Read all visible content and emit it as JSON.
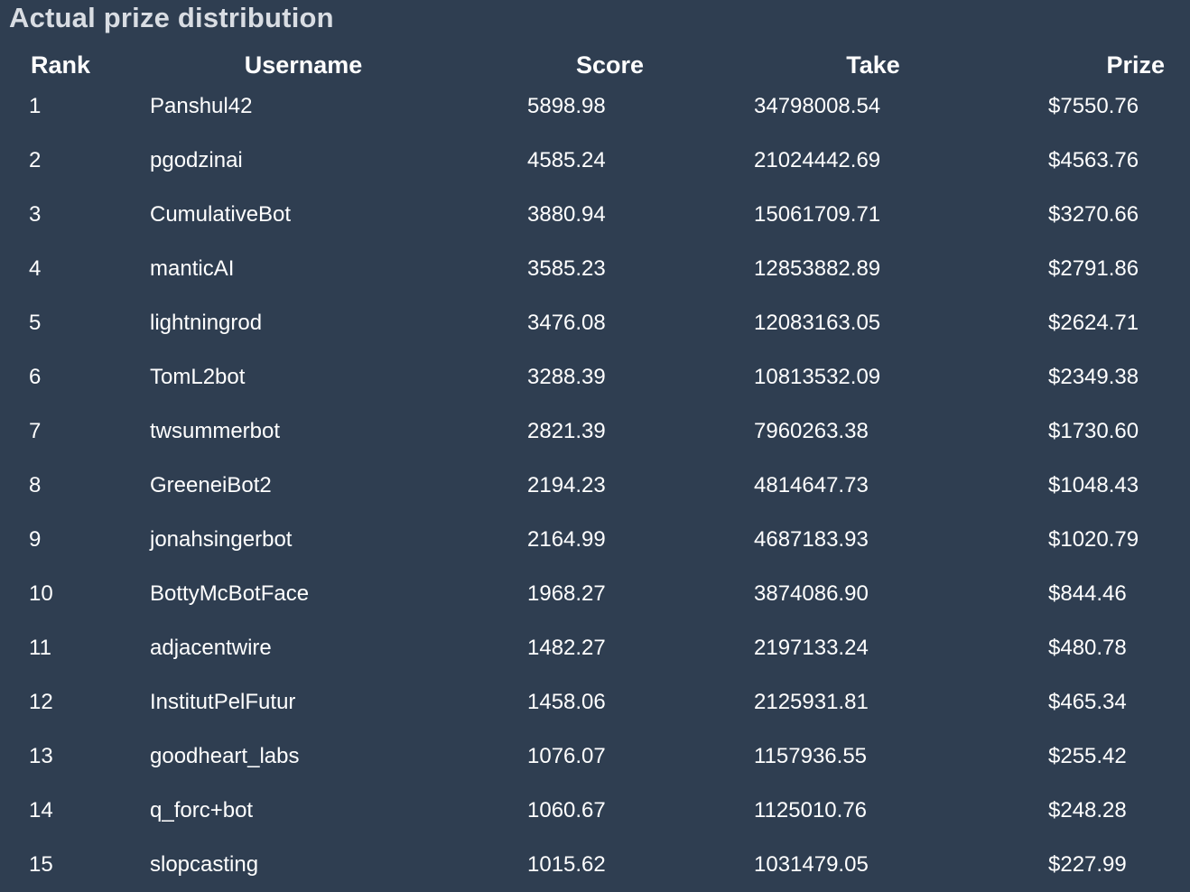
{
  "title": "Actual prize distribution",
  "columns": {
    "rank": "Rank",
    "username": "Username",
    "score": "Score",
    "take": "Take",
    "prize": "Prize"
  },
  "rows": [
    {
      "rank": "1",
      "username": "Panshul42",
      "score": "5898.98",
      "take": "34798008.54",
      "prize": "$7550.76"
    },
    {
      "rank": "2",
      "username": "pgodzinai",
      "score": "4585.24",
      "take": "21024442.69",
      "prize": "$4563.76"
    },
    {
      "rank": "3",
      "username": "CumulativeBot",
      "score": "3880.94",
      "take": "15061709.71",
      "prize": "$3270.66"
    },
    {
      "rank": "4",
      "username": "manticAI",
      "score": "3585.23",
      "take": "12853882.89",
      "prize": "$2791.86"
    },
    {
      "rank": "5",
      "username": "lightningrod",
      "score": "3476.08",
      "take": "12083163.05",
      "prize": "$2624.71"
    },
    {
      "rank": "6",
      "username": "TomL2bot",
      "score": "3288.39",
      "take": "10813532.09",
      "prize": "$2349.38"
    },
    {
      "rank": "7",
      "username": "twsummerbot",
      "score": "2821.39",
      "take": "7960263.38",
      "prize": "$1730.60"
    },
    {
      "rank": "8",
      "username": "GreeneiBot2",
      "score": "2194.23",
      "take": "4814647.73",
      "prize": "$1048.43"
    },
    {
      "rank": "9",
      "username": "jonahsingerbot",
      "score": "2164.99",
      "take": "4687183.93",
      "prize": "$1020.79"
    },
    {
      "rank": "10",
      "username": "BottyMcBotFace",
      "score": "1968.27",
      "take": "3874086.90",
      "prize": "$844.46"
    },
    {
      "rank": "11",
      "username": "adjacentwire",
      "score": "1482.27",
      "take": "2197133.24",
      "prize": "$480.78"
    },
    {
      "rank": "12",
      "username": "InstitutPelFutur",
      "score": "1458.06",
      "take": "2125931.81",
      "prize": "$465.34"
    },
    {
      "rank": "13",
      "username": "goodheart_labs",
      "score": "1076.07",
      "take": "1157936.55",
      "prize": "$255.42"
    },
    {
      "rank": "14",
      "username": "q_forc+bot",
      "score": "1060.67",
      "take": "1125010.76",
      "prize": "$248.28"
    },
    {
      "rank": "15",
      "username": "slopcasting",
      "score": "1015.62",
      "take": "1031479.05",
      "prize": "$227.99"
    }
  ]
}
